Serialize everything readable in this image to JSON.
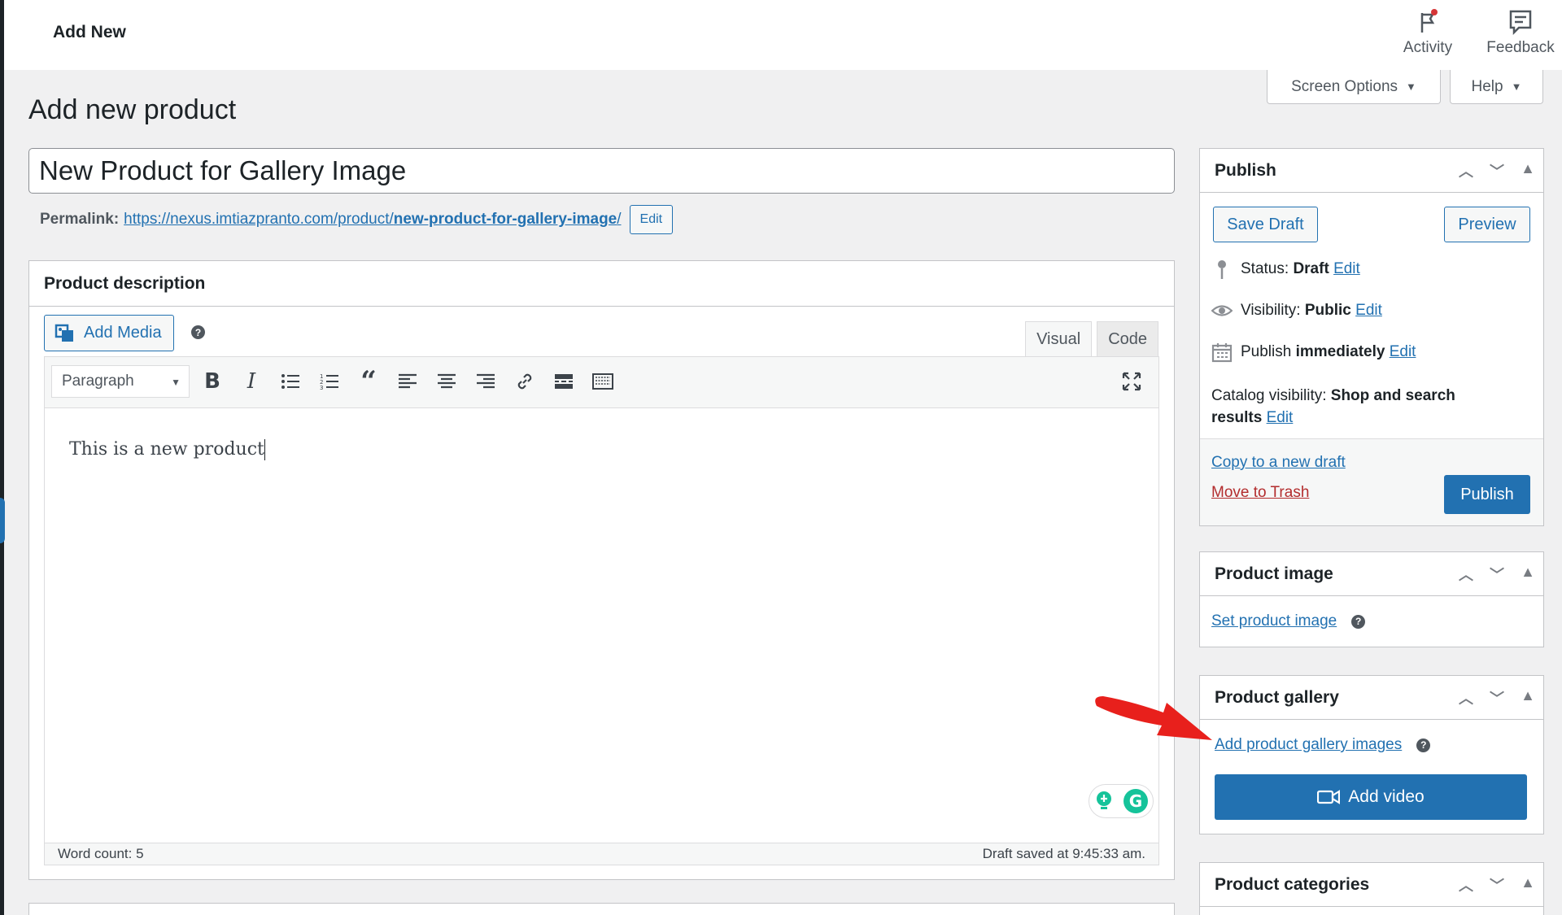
{
  "topbar": {
    "title": "Add New",
    "activity_label": "Activity",
    "feedback_label": "Feedback"
  },
  "screen_options_label": "Screen Options",
  "help_label": "Help",
  "page_title": "Add new product",
  "product_title": "New Product for Gallery Image",
  "permalink": {
    "label": "Permalink:",
    "url_base": "https://nexus.imtiazpranto.com/product/",
    "url_slug": "new-product-for-gallery-image",
    "url_tail": "/",
    "edit_label": "Edit"
  },
  "editor": {
    "header": "Product description",
    "add_media_label": "Add Media",
    "tab_visual": "Visual",
    "tab_code": "Code",
    "format_select": "Paragraph",
    "content": "This is a new product",
    "word_count": "Word count: 5",
    "draft_saved": "Draft saved at 9:45:33 am."
  },
  "publish_box": {
    "title": "Publish",
    "save_draft": "Save Draft",
    "preview": "Preview",
    "status_label": "Status:",
    "status_value": "Draft",
    "visibility_label": "Visibility:",
    "visibility_value": "Public",
    "publish_label": "Publish",
    "publish_value": "immediately",
    "edit_link": "Edit",
    "catalog_label": "Catalog visibility:",
    "catalog_value_1": "Shop and search",
    "catalog_value_2": "results",
    "copy_draft": "Copy to a new draft",
    "move_trash": "Move to Trash",
    "publish_button": "Publish"
  },
  "product_image": {
    "title": "Product image",
    "set_image": "Set product image"
  },
  "product_gallery": {
    "title": "Product gallery",
    "add_images": "Add product gallery images",
    "add_video": "Add video"
  },
  "product_categories": {
    "title": "Product categories"
  },
  "colors": {
    "accent": "#2271b1",
    "danger": "#b32d2e",
    "annotation_arrow": "#e8201c"
  }
}
